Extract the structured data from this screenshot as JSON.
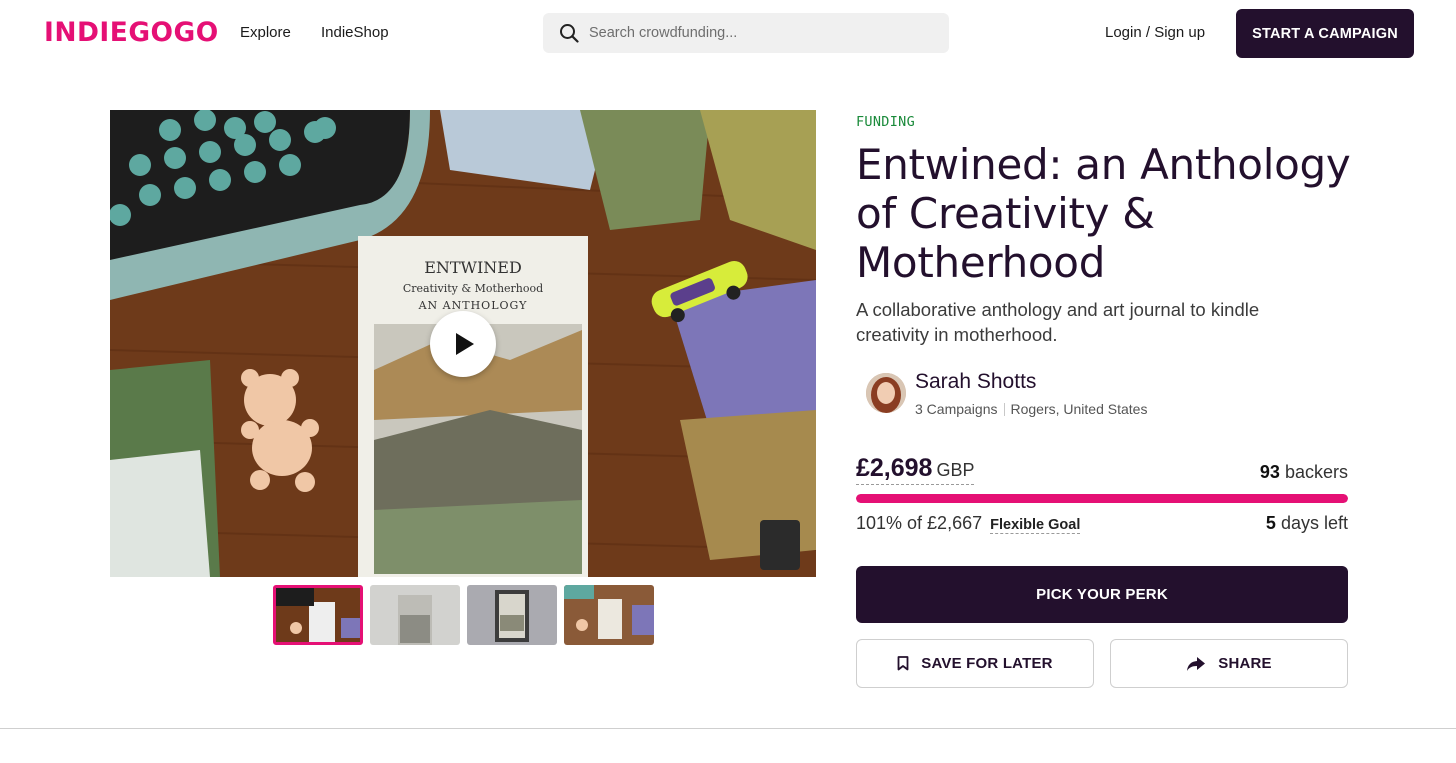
{
  "header": {
    "logo": "INDIEGOGO",
    "nav": [
      {
        "label": "Explore"
      },
      {
        "label": "IndieShop"
      }
    ],
    "search_placeholder": "Search crowdfunding...",
    "login_label": "Login / Sign up",
    "start_campaign_label": "START A CAMPAIGN"
  },
  "media": {
    "book_cover": {
      "title": "ENTWINED",
      "subtitle": "Creativity & Motherhood",
      "line3": "AN ANTHOLOGY"
    },
    "thumbnails_count": 4,
    "active_thumbnail": 0
  },
  "campaign": {
    "status": "FUNDING",
    "title": "Entwined: an Anthology of Creativity & Motherhood",
    "tagline": "A collaborative anthology and art journal to kindle creativity in motherhood.",
    "owner": {
      "name": "Sarah Shotts",
      "campaigns": "3 Campaigns",
      "location": "Rogers, United States"
    },
    "amount_raised": "£2,698",
    "currency": "GBP",
    "backers_count": "93",
    "backers_label": "backers",
    "progress_percent": 101,
    "goal_text": "101% of £2,667",
    "goal_type": "Flexible Goal",
    "days_left_count": "5",
    "days_left_label": "days left"
  },
  "actions": {
    "pick_perk": "PICK YOUR PERK",
    "save_for_later": "SAVE FOR LATER",
    "share": "SHARE"
  },
  "colors": {
    "brand_pink": "#e51075",
    "dark_purple": "#23102d",
    "funding_green": "#1a8a3a"
  }
}
